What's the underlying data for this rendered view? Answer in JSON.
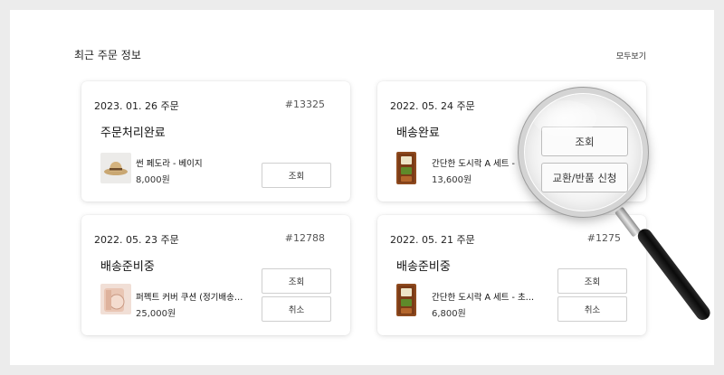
{
  "section": {
    "title": "최근 주문 정보",
    "view_all": "모두보기"
  },
  "orders": [
    {
      "date": "2023. 01. 26 주문",
      "order_no": "#13325",
      "status": "주문처리완료",
      "product": "썬 페도라 - 베이지",
      "price": "8,000원",
      "buttons": [
        "조회"
      ]
    },
    {
      "date": "2022. 05. 24 주문",
      "order_no": "",
      "status": "배송완료",
      "product": "간단한 도시락 A 세트 -",
      "price": "13,600원",
      "buttons": []
    },
    {
      "date": "2022. 05. 23 주문",
      "order_no": "#12788",
      "status": "배송준비중",
      "product": "퍼펙트 커버 쿠션 (정기배송…",
      "price": "25,000원",
      "buttons": [
        "조회",
        "취소"
      ]
    },
    {
      "date": "2022. 05. 21 주문",
      "order_no": "#1275",
      "status": "배송준비중",
      "product": "간단한 도시락 A 세트 - 초…",
      "price": "6,800원",
      "buttons": [
        "조회",
        "취소"
      ]
    }
  ],
  "magnifier": {
    "buttons": [
      "조회",
      "교환/반품 신청"
    ]
  },
  "icons": [
    "fedora-hat-image",
    "lunchbox-image",
    "cushion-image",
    "magnifier-icon"
  ]
}
